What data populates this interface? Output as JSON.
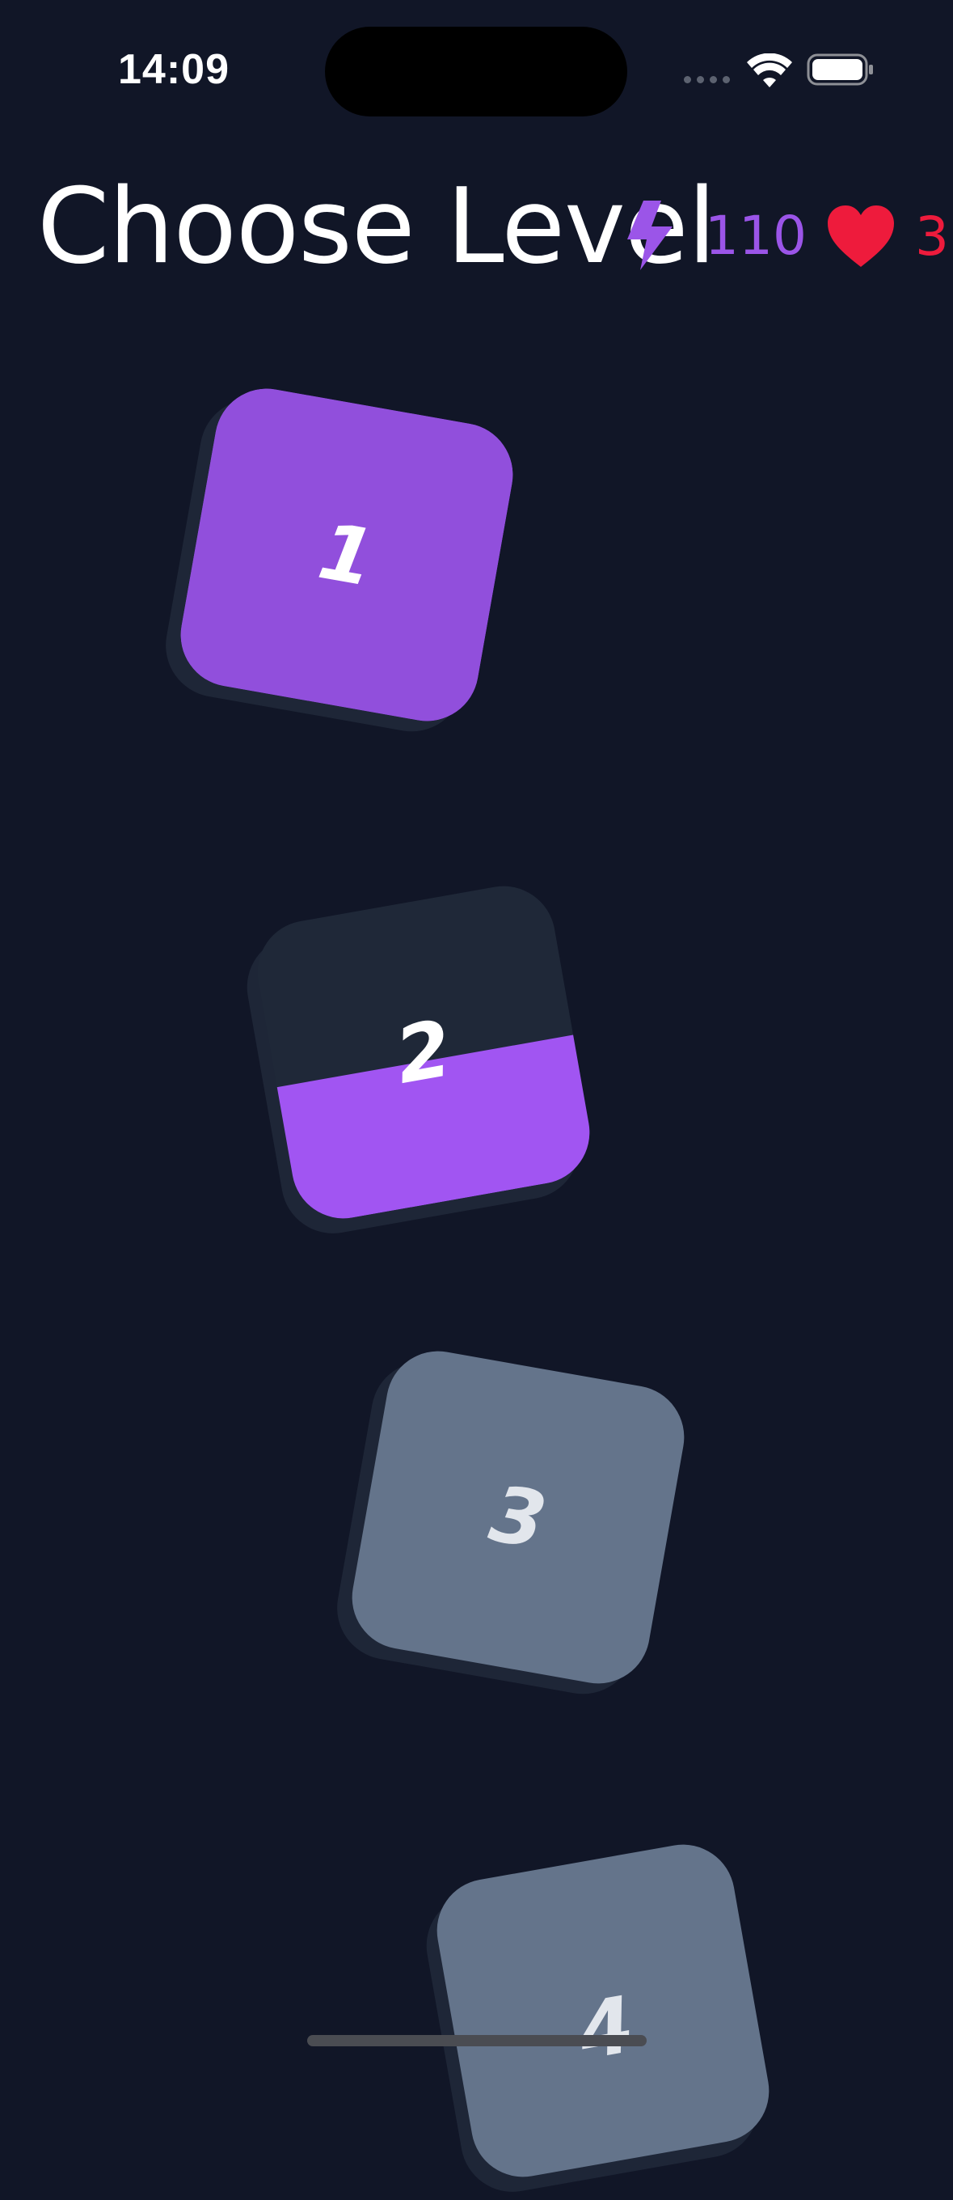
{
  "status_bar": {
    "time": "14:09"
  },
  "header": {
    "title": "Choose Level",
    "energy": {
      "icon": "lightning-bolt-icon",
      "value": "110",
      "color": "#9b55e8"
    },
    "lives": {
      "icon": "heart-icon",
      "value": "3",
      "color": "#ee1b3c"
    }
  },
  "levels": [
    {
      "number": "1",
      "state": "completed",
      "progress": 1.0,
      "face_color": "#914fdc",
      "fill_color": "#914fdc",
      "text_color": "#ffffff"
    },
    {
      "number": "2",
      "state": "in-progress",
      "progress": 0.47,
      "face_color": "#1f2838",
      "fill_color": "#a155f2",
      "text_color": "#ffffff"
    },
    {
      "number": "3",
      "state": "locked",
      "progress": 0,
      "face_color": "#64748b",
      "fill_color": "#64748b",
      "text_color": "#e2e6ec"
    },
    {
      "number": "4",
      "state": "locked",
      "progress": 0,
      "face_color": "#64748b",
      "fill_color": "#64748b",
      "text_color": "#e2e6ec"
    }
  ]
}
